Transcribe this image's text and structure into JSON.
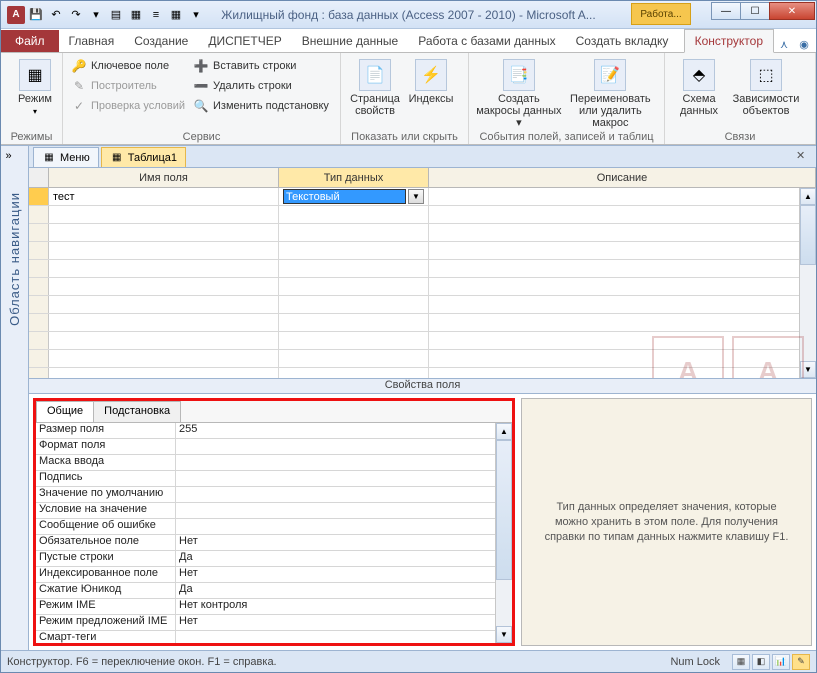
{
  "window": {
    "title": "Жилищный фонд : база данных (Access 2007 - 2010)  -  Microsoft A...",
    "tools_tab": "Работа..."
  },
  "qat": {
    "save": "💾",
    "undo": "↶",
    "redo": "↷"
  },
  "ribbon_tabs": {
    "file": "Файл",
    "home": "Главная",
    "create": "Создание",
    "dispatcher": "ДИСПЕТЧЕР",
    "external": "Внешние данные",
    "dbtools": "Работа с базами данных",
    "newtab": "Создать вкладку",
    "design": "Конструктор"
  },
  "ribbon": {
    "views": {
      "group": "Режимы",
      "btn": "Режим"
    },
    "tools": {
      "group": "Сервис",
      "key": "Ключевое поле",
      "builder": "Построитель",
      "test": "Проверка условий",
      "ins": "Вставить строки",
      "del": "Удалить строки",
      "modify": "Изменить подстановку"
    },
    "showhide": {
      "group": "Показать или скрыть",
      "prop": "Страница свойств",
      "idx": "Индексы"
    },
    "events": {
      "group": "События полей, записей и таблиц",
      "macros": "Создать макросы данных ▾",
      "rename": "Переименовать или удалить макрос"
    },
    "rel": {
      "group": "Связи",
      "schema": "Схема данных",
      "dep": "Зависимости объектов"
    }
  },
  "nav": {
    "title": "Область навигации"
  },
  "doc_tabs": {
    "menu": "Меню",
    "table": "Таблица1"
  },
  "grid": {
    "head": {
      "name": "Имя поля",
      "type": "Тип данных",
      "desc": "Описание"
    },
    "row": {
      "name": "тест",
      "type": "Текстовый"
    }
  },
  "split": "Свойства поля",
  "prop_tabs": {
    "general": "Общие",
    "lookup": "Подстановка"
  },
  "props": [
    {
      "k": "Размер поля",
      "v": "255"
    },
    {
      "k": "Формат поля",
      "v": ""
    },
    {
      "k": "Маска ввода",
      "v": ""
    },
    {
      "k": "Подпись",
      "v": ""
    },
    {
      "k": "Значение по умолчанию",
      "v": ""
    },
    {
      "k": "Условие на значение",
      "v": ""
    },
    {
      "k": "Сообщение об ошибке",
      "v": ""
    },
    {
      "k": "Обязательное поле",
      "v": "Нет"
    },
    {
      "k": "Пустые строки",
      "v": "Да"
    },
    {
      "k": "Индексированное поле",
      "v": "Нет"
    },
    {
      "k": "Сжатие Юникод",
      "v": "Да"
    },
    {
      "k": "Режим IME",
      "v": "Нет контроля"
    },
    {
      "k": "Режим предложений IME",
      "v": "Нет"
    },
    {
      "k": "Смарт-теги",
      "v": ""
    }
  ],
  "hint": "Тип данных определяет значения, которые можно хранить в этом поле. Для получения справки по типам данных нажмите клавишу F1.",
  "status": {
    "left": "Конструктор.  F6 = переключение окон.  F1 = справка.",
    "numlock": "Num Lock"
  }
}
